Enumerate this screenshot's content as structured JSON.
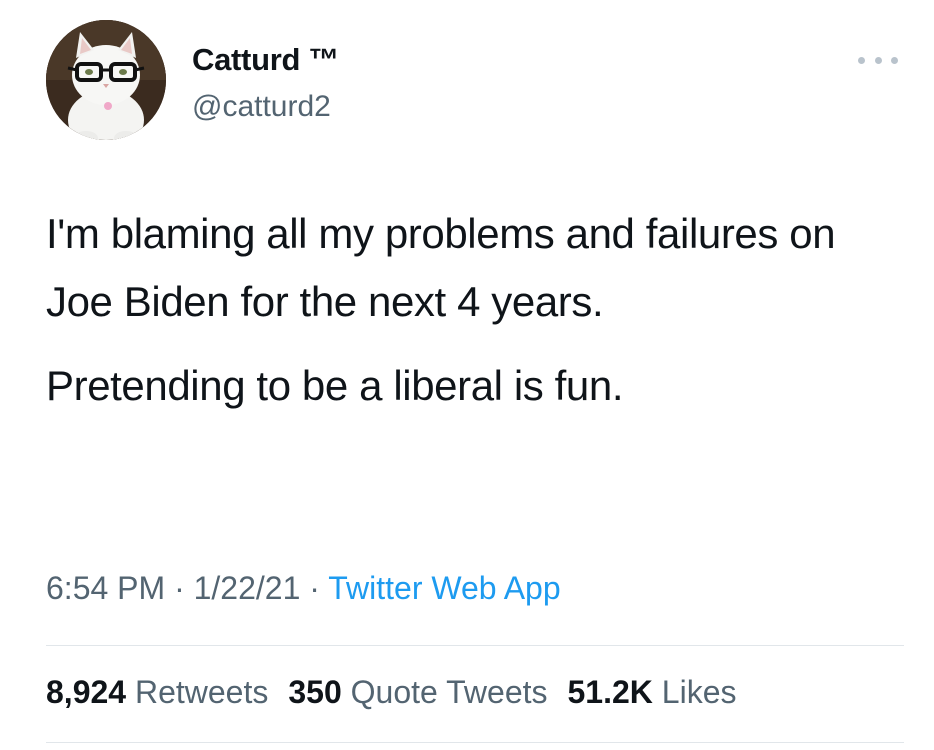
{
  "author": {
    "display_name": "Catturd ™",
    "handle": "@catturd2",
    "avatar_icon": "cat-with-glasses-avatar"
  },
  "more_icon": "ellipsis-icon",
  "tweet": {
    "paragraphs": [
      "I'm blaming all my problems and failures on Joe Biden for the next 4 years.",
      "Pretending to be a liberal is fun."
    ],
    "time": "6:54 PM",
    "date": "1/22/21",
    "separator": "·",
    "source": "Twitter Web App"
  },
  "stats": {
    "retweets_count": "8,924",
    "retweets_label": "Retweets",
    "quotes_count": "350",
    "quotes_label": "Quote Tweets",
    "likes_count": "51.2K",
    "likes_label": "Likes"
  },
  "colors": {
    "text": "#0f1419",
    "secondary": "#536471",
    "link": "#1d9bf0",
    "divider": "#e1e6ea"
  }
}
